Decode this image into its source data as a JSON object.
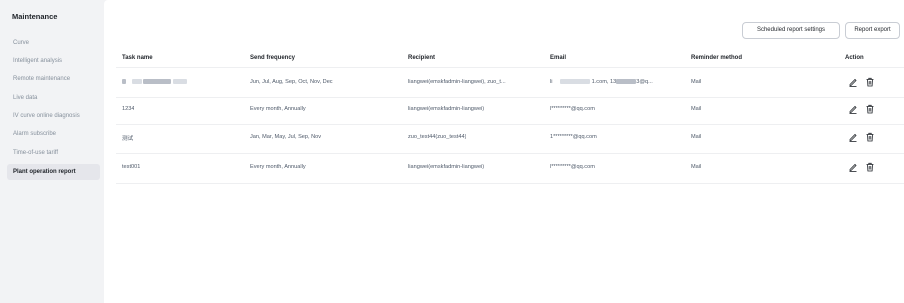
{
  "sidebar": {
    "title": "Maintenance",
    "items": [
      {
        "label": "Curve"
      },
      {
        "label": "Intelligent analysis"
      },
      {
        "label": "Remote maintenance"
      },
      {
        "label": "Live data"
      },
      {
        "label": "IV curve online diagnosis"
      },
      {
        "label": "Alarm subscribe"
      },
      {
        "label": "Time-of-use tariff"
      },
      {
        "label": "Plant operation report",
        "active": true
      }
    ]
  },
  "toolbar": {
    "scheduled_label": "Scheduled report settings",
    "export_label": "Report export"
  },
  "table": {
    "columns": [
      "Task name",
      "Send frequency",
      "Recipient",
      "Email",
      "Reminder method",
      "Action"
    ],
    "rows": [
      {
        "task": "",
        "frequency": "Jun, Jul, Aug, Sep, Oct, Nov, Dec",
        "recipient": "liangwei(emskfadmin-liangwei), zuo_t...",
        "email_prefix": "li",
        "email_mid": "1.com, 13",
        "email_suffix": "3@q...",
        "reminder": "Mail"
      },
      {
        "task": "1234",
        "frequency": "Every month, Annually",
        "recipient": "liangwei(emskfadmin-liangwei)",
        "email": "l*********@qq.com",
        "reminder": "Mail"
      },
      {
        "task": "测试",
        "frequency": "Jan, Mar, May, Jul, Sep, Nov",
        "recipient": "zuo_test44(zuo_test44)",
        "email": "1*********@qq.com",
        "reminder": "Mail"
      },
      {
        "task": "test001",
        "frequency": "Every month, Annually",
        "recipient": "liangwei(emskfadmin-liangwei)",
        "email": "l*********@qq.com",
        "reminder": "Mail"
      }
    ]
  },
  "icons": {
    "edit": "pencil-edit-icon",
    "delete": "trash-delete-icon"
  },
  "colors": {
    "active_item_bg": "#e5e6eb",
    "muted_text": "#86909c",
    "border": "#c9cdd4"
  }
}
